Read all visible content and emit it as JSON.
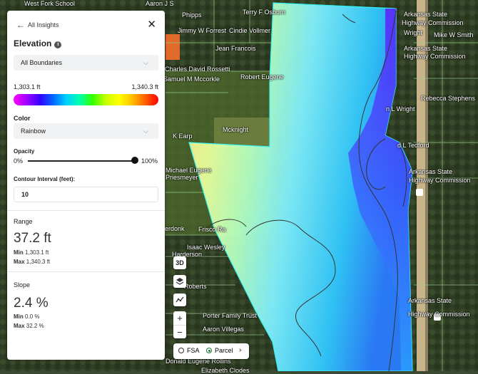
{
  "panel": {
    "back_label": "All Insights",
    "title": "Elevation",
    "boundary_select": "All Boundaries",
    "legend_min": "1,303.1 ft",
    "legend_max": "1,340.3 ft",
    "color_label": "Color",
    "color_select": "Rainbow",
    "opacity_label": "Opacity",
    "opacity_min": "0%",
    "opacity_max": "100%",
    "opacity_value": 1.0,
    "contour_label": "Contour Interval (feet):",
    "contour_value": "10",
    "range": {
      "label": "Range",
      "value": "37.2 ft",
      "min_label": "Min",
      "min_value": "1,303.1 ft",
      "max_label": "Max",
      "max_value": "1,340.3 ft"
    },
    "slope": {
      "label": "Slope",
      "value": "2.4 %",
      "min_label": "Min",
      "min_value": "0.0 %",
      "max_label": "Max",
      "max_value": "32.2 %"
    }
  },
  "map_controls": {
    "three_d": "3D",
    "zoom_in": "+",
    "zoom_out": "−",
    "layer_fsa": "FSA",
    "layer_parcel": "Parcel",
    "selected_layer": "Parcel"
  },
  "map_labels": [
    "West Fork School",
    "Aaron J S",
    "Phipps",
    "Jimmy W Forrest",
    "Cindie Vollmer",
    "Jean Francois",
    "Terry F Osburn",
    "Arkansas State",
    "Highway Commission",
    "Wright",
    "Mike W Smith",
    "Arkansas State",
    "Highway Commission",
    "Robert Eugene",
    "Charles David Rossetti",
    "Samuel M Mccorkle",
    "Rebecca Stephens",
    "n L Wright",
    "Mcknight",
    "K Earp",
    "d L Tedford",
    "Michael Eugene",
    "Priesmeyer",
    "Arkansas State",
    "Highway Commission",
    "Frisco Ra",
    "erdonk",
    "Isaac Wesley",
    "Harderson",
    "Roberts",
    "Arkansas State",
    "Highway Commission",
    "Porter Family Trust",
    "Aaron Villegas",
    "Donald Eugene Rollins",
    "Elizabeth Clodes"
  ]
}
